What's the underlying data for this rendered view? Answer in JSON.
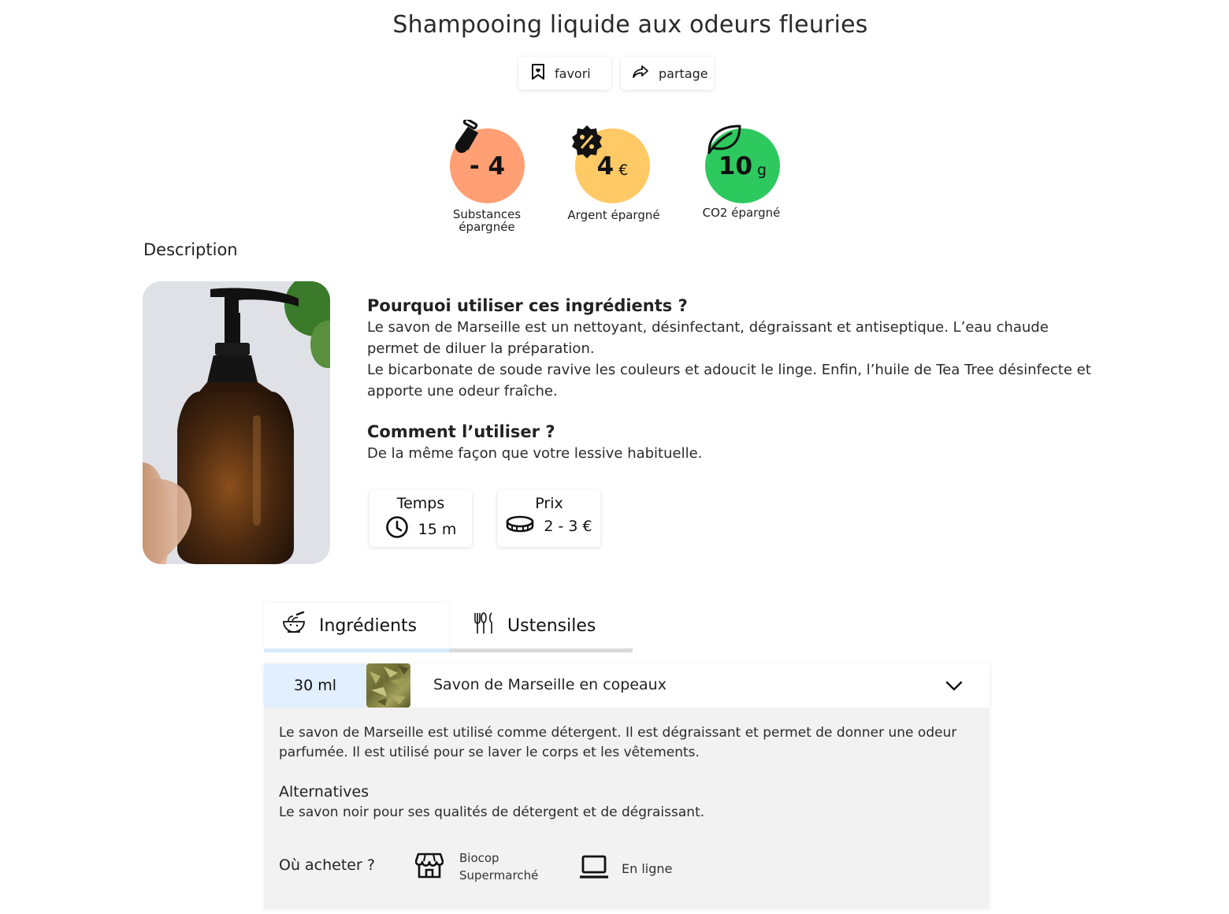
{
  "page": {
    "title": "Shampooing liquide aux odeurs fleuries"
  },
  "actions": {
    "favorite_label": "favori",
    "share_label": "partage"
  },
  "stats": [
    {
      "value": "- 4",
      "unit": "",
      "label": "Substances\népargnée",
      "color": "#ff9f73",
      "icon": "flask-icon"
    },
    {
      "value": "4",
      "unit": "€",
      "label": "Argent épargné",
      "color": "#ffc966",
      "icon": "discount-badge-icon"
    },
    {
      "value": "10",
      "unit": "g",
      "label": "CO2 épargné",
      "color": "#2dc95e",
      "icon": "leaf-icon"
    }
  ],
  "description": {
    "heading": "Description",
    "why_title": "Pourquoi utiliser ces ingrédients ?",
    "why_text_1": "Le savon de Marseille est un nettoyant, désinfectant, dégraissant et antiseptique. L’eau chaude permet de diluer la préparation.",
    "why_text_2": "Le bicarbonate de soude ravive les couleurs et adoucit le linge. Enfin, l’huile de Tea Tree désinfecte et apporte une odeur fraîche.",
    "how_title": "Comment l’utiliser ?",
    "how_text": "De la même façon que votre lessive habituelle."
  },
  "info": {
    "time_title": "Temps",
    "time_value": "15 m",
    "price_title": "Prix",
    "price_value": "2 - 3 €"
  },
  "tabs": [
    {
      "label": "Ingrédients",
      "icon": "mortar-bowl-icon",
      "active": true
    },
    {
      "label": "Ustensiles",
      "icon": "utensils-icon",
      "active": false
    }
  ],
  "ingredient": {
    "quantity": "30 ml",
    "name": "Savon de Marseille en copeaux",
    "description": "Le savon de Marseille est utilisé comme détergent. Il est dégraissant et permet de donner une odeur parfumée. Il est utilisé pour se laver le corps et les vêtements.",
    "alternatives_title": "Alternatives",
    "alternatives_text": "Le savon noir pour ses qualités de détergent et de dégraissant.",
    "buy_title": "Où acheter ?",
    "buy_store_line1": "Biocop",
    "buy_store_line2": "Supermarché",
    "buy_online": "En ligne"
  }
}
